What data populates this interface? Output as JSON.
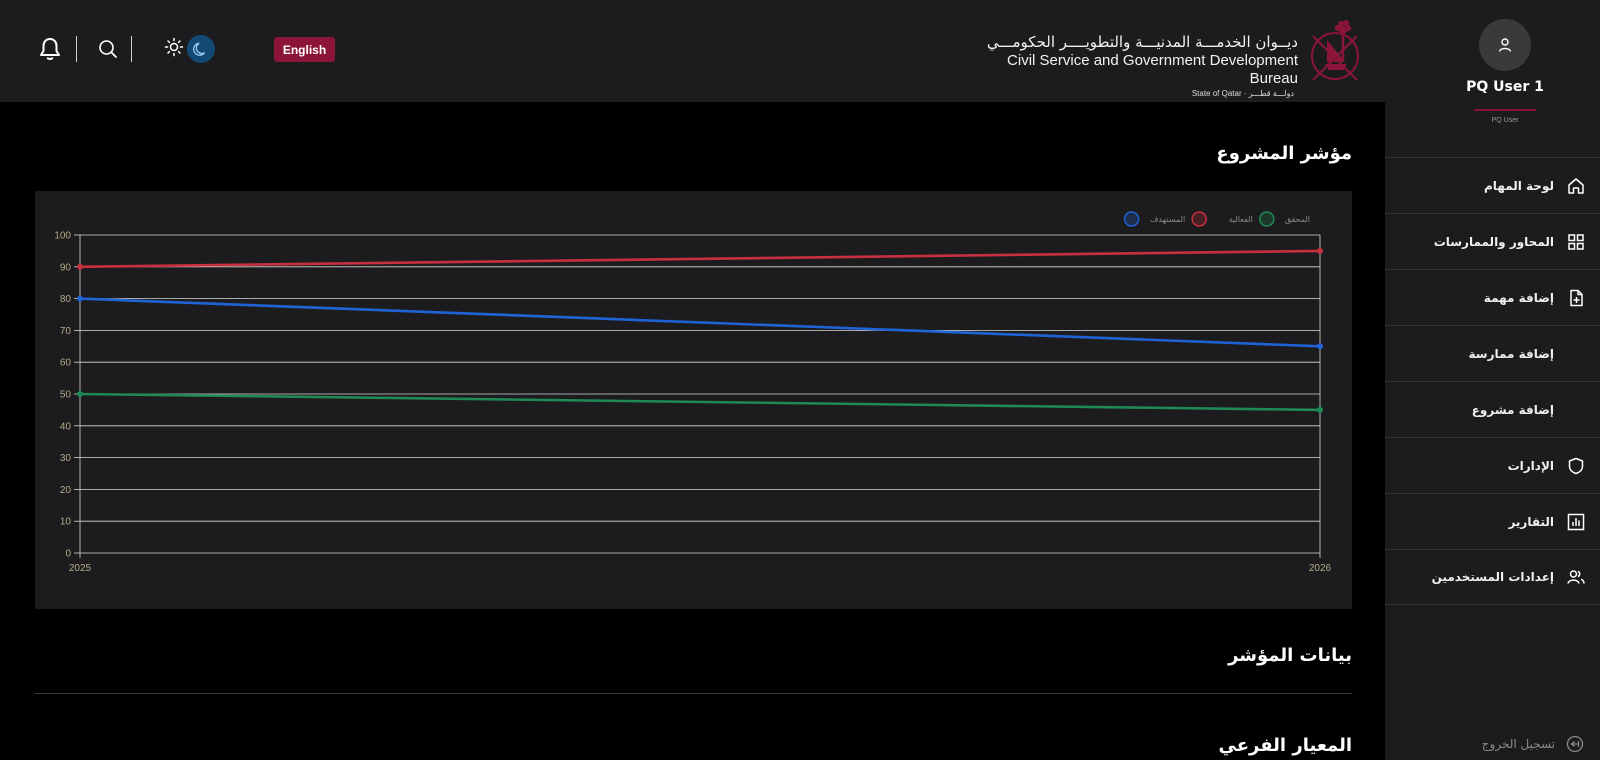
{
  "header": {
    "language_button": "English",
    "logo": {
      "arabic_title": "ديــوان الخدمـــة المدنيـــة والتطويــــر الحكومـــي",
      "english_title": "Civil Service and Government Development Bureau",
      "state_line": "State of Qatar · دولـــة قطـــر"
    },
    "icons": [
      "bell-icon",
      "search-icon",
      "sun-icon",
      "moon-icon"
    ],
    "accent_color": "#8b1538",
    "toggle_color": "#124a73"
  },
  "sidebar": {
    "user": {
      "name": "PQ User 1",
      "role": "PQ User"
    },
    "items": [
      {
        "label": "لوحة المهام",
        "icon": "home-icon"
      },
      {
        "label": "المحاور والممارسات",
        "icon": "grid-icon"
      },
      {
        "label": "إضافة مهمة",
        "icon": "file-plus-icon"
      },
      {
        "label": "إضافة ممارسة",
        "icon": ""
      },
      {
        "label": "إضافة مشروع",
        "icon": ""
      },
      {
        "label": "الإدارات",
        "icon": "shield-icon"
      },
      {
        "label": "التقارير",
        "icon": "bar-chart-icon"
      },
      {
        "label": "إعدادات المستخدمين",
        "icon": "users-icon"
      }
    ],
    "logout_label": "تسجيل الخروج"
  },
  "main": {
    "chart_title": "مؤشر المشروع",
    "data_title": "بيانات المؤشر",
    "sub_standard_title": "المعيار الفرعي"
  },
  "chart_data": {
    "type": "line",
    "x": [
      "2025",
      "2026"
    ],
    "ylim": [
      0,
      100
    ],
    "yticks": [
      0,
      10,
      20,
      30,
      40,
      50,
      60,
      70,
      80,
      90,
      100
    ],
    "grid": true,
    "legend_position": "top-right",
    "series": [
      {
        "name": "المستهدف",
        "color": "#1f63d6",
        "values": [
          80,
          65
        ]
      },
      {
        "name": "الفعالية",
        "color": "#c8303f",
        "values": [
          90,
          95
        ]
      },
      {
        "name": "المحقق",
        "color": "#1f8a55",
        "values": [
          50,
          45
        ]
      }
    ]
  }
}
